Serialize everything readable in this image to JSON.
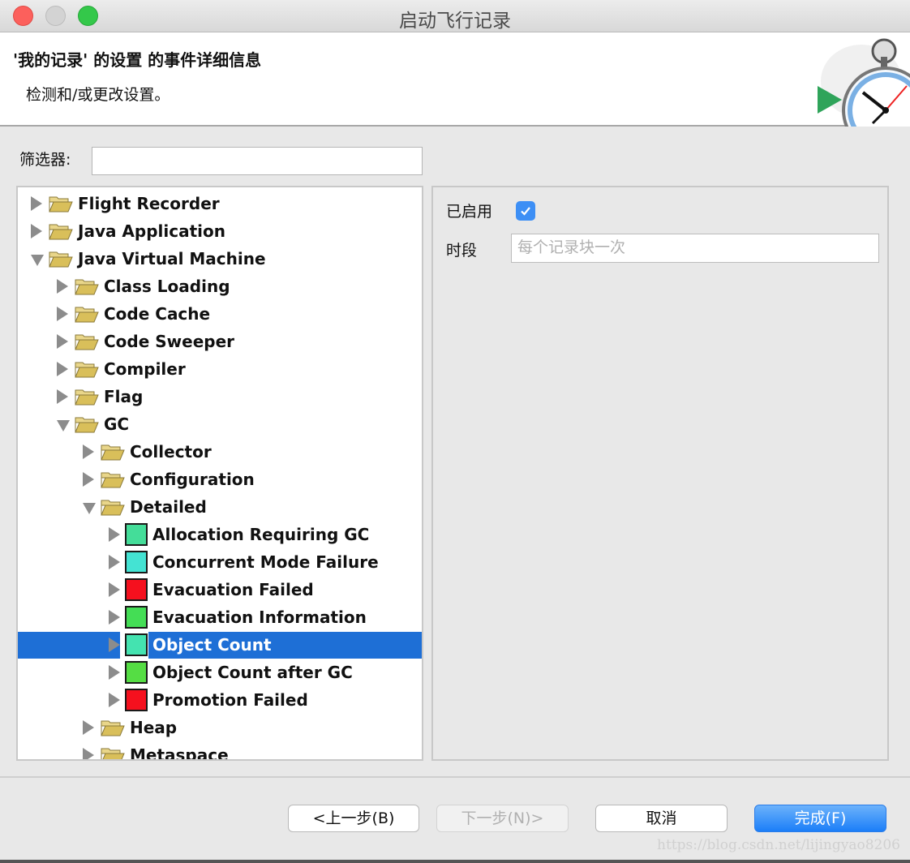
{
  "window": {
    "title": "启动飞行记录",
    "controls": [
      "close",
      "minimize",
      "maximize"
    ]
  },
  "header": {
    "title": "'我的记录' 的设置 的事件详细信息",
    "subtitle": "检测和/或更改设置。",
    "icon": "stopwatch-icon"
  },
  "filter": {
    "label": "筛选器:",
    "value": "",
    "placeholder": ""
  },
  "tree": {
    "items": [
      {
        "label": "Flight Recorder",
        "level": 0,
        "type": "folder",
        "expanded": false
      },
      {
        "label": "Java Application",
        "level": 0,
        "type": "folder",
        "expanded": false
      },
      {
        "label": "Java Virtual Machine",
        "level": 0,
        "type": "folder",
        "expanded": true
      },
      {
        "label": "Class Loading",
        "level": 1,
        "type": "folder",
        "expanded": false
      },
      {
        "label": "Code Cache",
        "level": 1,
        "type": "folder",
        "expanded": false
      },
      {
        "label": "Code Sweeper",
        "level": 1,
        "type": "folder",
        "expanded": false
      },
      {
        "label": "Compiler",
        "level": 1,
        "type": "folder",
        "expanded": false
      },
      {
        "label": "Flag",
        "level": 1,
        "type": "folder",
        "expanded": false
      },
      {
        "label": "GC",
        "level": 1,
        "type": "folder",
        "expanded": true
      },
      {
        "label": "Collector",
        "level": 2,
        "type": "folder",
        "expanded": false
      },
      {
        "label": "Configuration",
        "level": 2,
        "type": "folder",
        "expanded": false
      },
      {
        "label": "Detailed",
        "level": 2,
        "type": "folder",
        "expanded": true
      },
      {
        "label": "Allocation Requiring GC",
        "level": 3,
        "type": "event",
        "color": "#44dd99",
        "expanded": false
      },
      {
        "label": "Concurrent Mode Failure",
        "level": 3,
        "type": "event",
        "color": "#44e3d3",
        "expanded": false
      },
      {
        "label": "Evacuation Failed",
        "level": 3,
        "type": "event",
        "color": "#f5101e",
        "expanded": false
      },
      {
        "label": "Evacuation Information",
        "level": 3,
        "type": "event",
        "color": "#44dd55",
        "expanded": false
      },
      {
        "label": "Object Count",
        "level": 3,
        "type": "event",
        "color": "#44e3b0",
        "expanded": false,
        "selected": true
      },
      {
        "label": "Object Count after GC",
        "level": 3,
        "type": "event",
        "color": "#55dd44",
        "expanded": false
      },
      {
        "label": "Promotion Failed",
        "level": 3,
        "type": "event",
        "color": "#f5101e",
        "expanded": false
      },
      {
        "label": "Heap",
        "level": 2,
        "type": "folder",
        "expanded": false
      },
      {
        "label": "Metaspace",
        "level": 2,
        "type": "folder",
        "expanded": false
      }
    ]
  },
  "settings": {
    "enabled_label": "已启用",
    "enabled": true,
    "period_label": "时段",
    "period_value": "",
    "period_placeholder": "每个记录块一次"
  },
  "buttons": {
    "back": "<上一步(B)",
    "next": "下一步(N)>",
    "cancel": "取消",
    "finish": "完成(F)"
  },
  "watermark": "https://blog.csdn.net/lijingyao8206",
  "colors": {
    "selection": "#1e6fd6",
    "checkbox": "#3d8ff5",
    "primary_button": "#1b7ef8"
  }
}
